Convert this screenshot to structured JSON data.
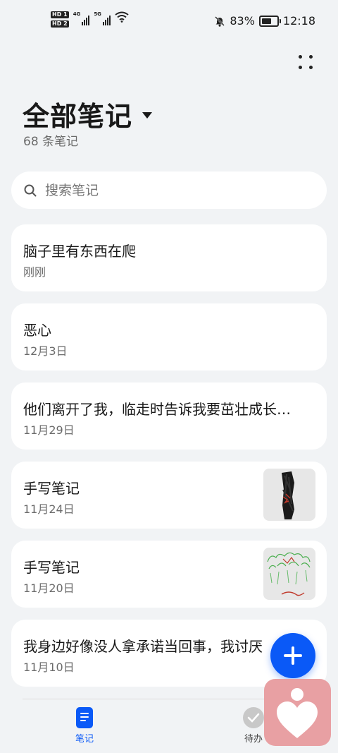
{
  "status_bar": {
    "hd1": "HD 1",
    "hd2": "HD 2",
    "net1": "4G",
    "net2": "5G",
    "battery": "83%",
    "battery_level": 0.83,
    "time": "12:18"
  },
  "header": {
    "title": "全部笔记",
    "count": "68 条笔记"
  },
  "search": {
    "placeholder": "搜索笔记"
  },
  "notes": [
    {
      "title": "脑子里有东西在爬",
      "date": "刚刚"
    },
    {
      "title": "恶心",
      "date": "12月3日"
    },
    {
      "title": "他们离开了我，临走时告诉我要茁壮成长…",
      "date": "11月29日"
    },
    {
      "title": "手写笔记",
      "date": "11月24日",
      "thumbnail": "handwriting-thumbnail-dark"
    },
    {
      "title": "手写笔记",
      "date": "11月20日",
      "thumbnail": "handwriting-thumbnail-green"
    },
    {
      "title": "我身边好像没人拿承诺当回事，我讨厌",
      "date": "11月10日"
    }
  ],
  "bottom_nav": {
    "notes_label": "笔记",
    "todo_label": "待办"
  },
  "colors": {
    "accent": "#0a59f7",
    "background": "#f1f3f5",
    "card": "#ffffff",
    "widget": "#e8a0a3"
  }
}
